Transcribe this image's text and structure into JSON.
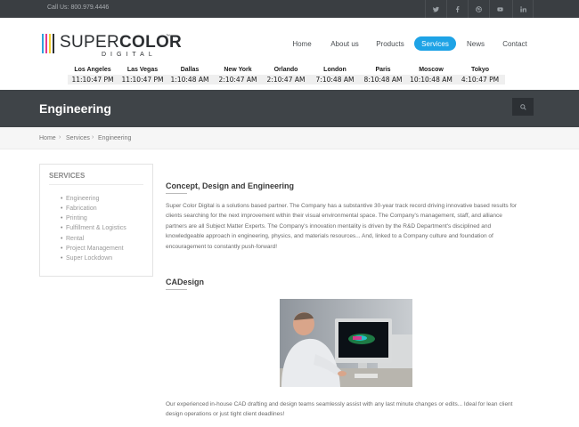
{
  "topbar": {
    "phone": "Call Us: 800.979.4446",
    "social_icons": [
      "twitter-icon",
      "facebook-icon",
      "dribbble-icon",
      "youtube-icon",
      "linkedin-icon"
    ]
  },
  "logo": {
    "word_light": "SUPER",
    "word_bold": "COLOR",
    "trademark": "™",
    "subline": "DIGITAL",
    "bar_colors": [
      "#2ea3dd",
      "#e23a8f",
      "#f5cf2b",
      "#2b2e31"
    ]
  },
  "nav": {
    "items": [
      "Home",
      "About us",
      "Products",
      "Services",
      "News",
      "Contact"
    ],
    "active": "Services",
    "accent": "#1ea3e6"
  },
  "clocks": [
    {
      "city": "Los Angeles",
      "time": "11:10:47 PM"
    },
    {
      "city": "Las Vegas",
      "time": "11:10:47 PM"
    },
    {
      "city": "Dallas",
      "time": "1:10:48 AM"
    },
    {
      "city": "New York",
      "time": "2:10:47 AM"
    },
    {
      "city": "Orlando",
      "time": "2:10:47 AM"
    },
    {
      "city": "London",
      "time": "7:10:48 AM"
    },
    {
      "city": "Paris",
      "time": "8:10:48 AM"
    },
    {
      "city": "Moscow",
      "time": "10:10:48 AM"
    },
    {
      "city": "Tokyo",
      "time": "4:10:47 PM"
    }
  ],
  "page_title": "Engineering",
  "breadcrumb": [
    "Home",
    "Services",
    "Engineering"
  ],
  "sidebar": {
    "heading": "SERVICES",
    "items": [
      "Engineering",
      "Fabrication",
      "Printing",
      "Fulfillment & Logistics",
      "Rental",
      "Project Management",
      "Super Lockdown"
    ]
  },
  "content": {
    "section1_title": "Concept, Design and Engineering",
    "section1_lines": [
      "Super Color Digital is a solutions based partner.  The Company has a substantive 30-year track record driving innovative based results for",
      "clients searching for the next improvement within their visual environmental space.  The Company's management, staff, and alliance",
      "partners are all Subject Matter Experts.  The Company's innovation mentality is driven by the R&D Department's disciplined and",
      "knowledgeable approach in engineering, physics, and materials resources...  And, linked to a Company culture and foundation of",
      "encouragement to constantly push-forward!"
    ],
    "section2_title": "CADesign",
    "section2_lines": [
      "Our experienced in-house CAD drafting and design teams seamlessly assist with any last minute changes or edits...  Ideal for lean client",
      "design operations or just tight client deadlines!"
    ]
  }
}
